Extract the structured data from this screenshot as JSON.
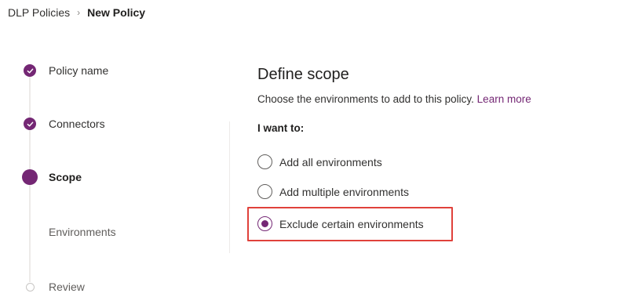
{
  "breadcrumb": {
    "parent": "DLP Policies",
    "separator": "›",
    "current": "New Policy"
  },
  "steps": [
    {
      "label": "Policy name",
      "status": "done"
    },
    {
      "label": "Connectors",
      "status": "done"
    },
    {
      "label": "Scope",
      "status": "current"
    },
    {
      "label": "Environments",
      "status": "substep"
    },
    {
      "label": "Review",
      "status": "future"
    }
  ],
  "main": {
    "title": "Define scope",
    "description": "Choose the environments to add to this policy.",
    "learn_more": "Learn more",
    "prompt": "I want to:",
    "options": [
      {
        "label": "Add all environments",
        "checked": false
      },
      {
        "label": "Add multiple environments",
        "checked": false
      },
      {
        "label": "Exclude certain environments",
        "checked": true
      }
    ]
  },
  "colors": {
    "accent": "#742774",
    "highlight_border": "#e0413b"
  },
  "icons": {
    "check": "checkmark-icon",
    "separator": "chevron-right-icon"
  }
}
